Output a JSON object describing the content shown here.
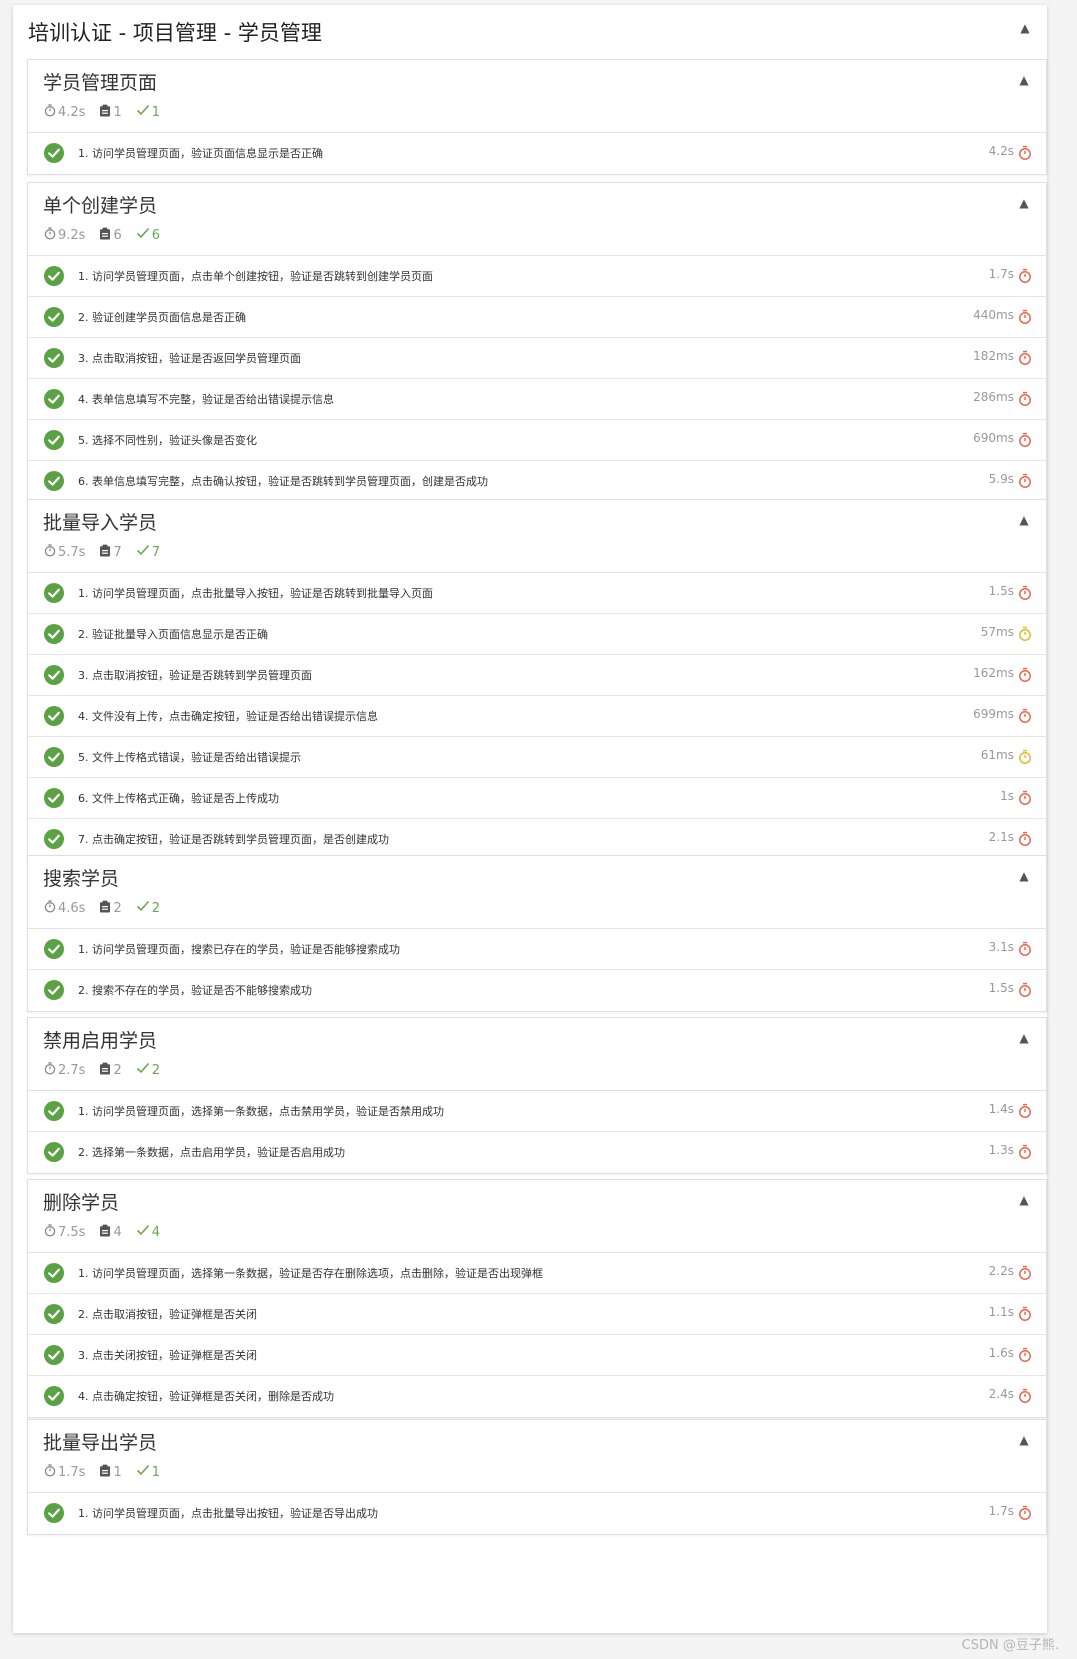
{
  "panel": {
    "title": "培训认证 - 项目管理 - 学员管理"
  },
  "colors": {
    "pass": "#5aa244",
    "slow": "#e8694f",
    "fast": "#e7b92f",
    "muted": "#999999"
  },
  "suites": [
    {
      "title": "学员管理页面",
      "duration": "4.2s",
      "tests": "1",
      "passed": "1",
      "items": [
        {
          "label": "1. 访问学员管理页面，验证页面信息显示是否正确",
          "duration": "4.2s",
          "speed": "slow"
        }
      ]
    },
    {
      "title": "单个创建学员",
      "duration": "9.2s",
      "tests": "6",
      "passed": "6",
      "items": [
        {
          "label": "1. 访问学员管理页面，点击单个创建按钮，验证是否跳转到创建学员页面",
          "duration": "1.7s",
          "speed": "slow"
        },
        {
          "label": "2. 验证创建学员页面信息是否正确",
          "duration": "440ms",
          "speed": "slow"
        },
        {
          "label": "3. 点击取消按钮，验证是否返回学员管理页面",
          "duration": "182ms",
          "speed": "slow"
        },
        {
          "label": "4. 表单信息填写不完整，验证是否给出错误提示信息",
          "duration": "286ms",
          "speed": "slow"
        },
        {
          "label": "5. 选择不同性别，验证头像是否变化",
          "duration": "690ms",
          "speed": "slow"
        },
        {
          "label": "6. 表单信息填写完整，点击确认按钮，验证是否跳转到学员管理页面，创建是否成功",
          "duration": "5.9s",
          "speed": "slow"
        }
      ]
    },
    {
      "title": "批量导入学员",
      "duration": "5.7s",
      "tests": "7",
      "passed": "7",
      "items": [
        {
          "label": "1. 访问学员管理页面，点击批量导入按钮，验证是否跳转到批量导入页面",
          "duration": "1.5s",
          "speed": "slow"
        },
        {
          "label": "2. 验证批量导入页面信息显示是否正确",
          "duration": "57ms",
          "speed": "fast"
        },
        {
          "label": "3. 点击取消按钮，验证是否跳转到学员管理页面",
          "duration": "162ms",
          "speed": "slow"
        },
        {
          "label": "4. 文件没有上传，点击确定按钮，验证是否给出错误提示信息",
          "duration": "699ms",
          "speed": "slow"
        },
        {
          "label": "5. 文件上传格式错误，验证是否给出错误提示",
          "duration": "61ms",
          "speed": "fast"
        },
        {
          "label": "6. 文件上传格式正确，验证是否上传成功",
          "duration": "1s",
          "speed": "slow"
        },
        {
          "label": "7. 点击确定按钮，验证是否跳转到学员管理页面，是否创建成功",
          "duration": "2.1s",
          "speed": "slow"
        }
      ]
    },
    {
      "title": "搜索学员",
      "duration": "4.6s",
      "tests": "2",
      "passed": "2",
      "items": [
        {
          "label": "1. 访问学员管理页面，搜索已存在的学员，验证是否能够搜索成功",
          "duration": "3.1s",
          "speed": "slow"
        },
        {
          "label": "2. 搜索不存在的学员，验证是否不能够搜索成功",
          "duration": "1.5s",
          "speed": "slow"
        }
      ]
    },
    {
      "title": "禁用启用学员",
      "duration": "2.7s",
      "tests": "2",
      "passed": "2",
      "items": [
        {
          "label": "1. 访问学员管理页面，选择第一条数据，点击禁用学员，验证是否禁用成功",
          "duration": "1.4s",
          "speed": "slow"
        },
        {
          "label": "2. 选择第一条数据，点击启用学员，验证是否启用成功",
          "duration": "1.3s",
          "speed": "slow"
        }
      ]
    },
    {
      "title": "删除学员",
      "duration": "7.5s",
      "tests": "4",
      "passed": "4",
      "items": [
        {
          "label": "1. 访问学员管理页面，选择第一条数据，验证是否存在删除选项，点击删除，验证是否出现弹框",
          "duration": "2.2s",
          "speed": "slow"
        },
        {
          "label": "2. 点击取消按钮，验证弹框是否关闭",
          "duration": "1.1s",
          "speed": "slow"
        },
        {
          "label": "3. 点击关闭按钮，验证弹框是否关闭",
          "duration": "1.6s",
          "speed": "slow"
        },
        {
          "label": "4. 点击确定按钮，验证弹框是否关闭，删除是否成功",
          "duration": "2.4s",
          "speed": "slow"
        }
      ]
    },
    {
      "title": "批量导出学员",
      "duration": "1.7s",
      "tests": "1",
      "passed": "1",
      "items": [
        {
          "label": "1. 访问学员管理页面，点击批量导出按钮，验证是否导出成功",
          "duration": "1.7s",
          "speed": "slow"
        }
      ]
    }
  ],
  "watermark": "CSDN @豆子熊."
}
